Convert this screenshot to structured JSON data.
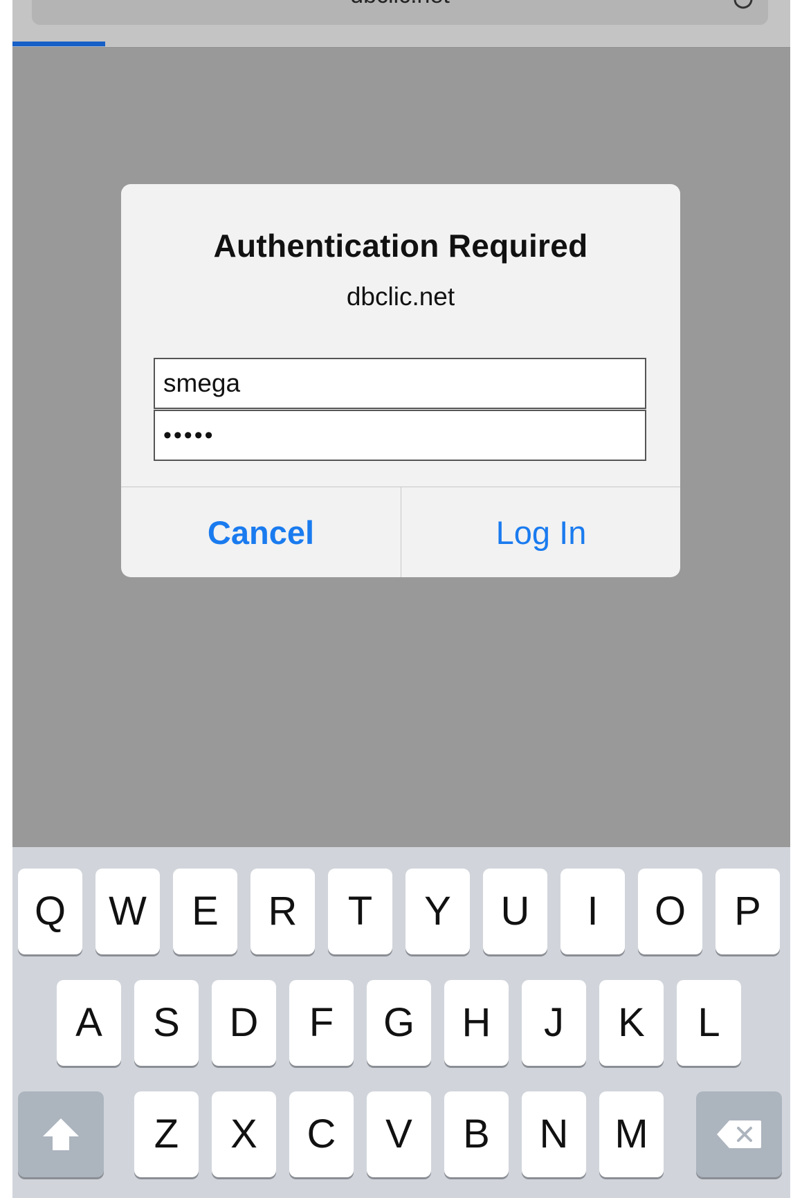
{
  "browser": {
    "url": "dbclic.net"
  },
  "dialog": {
    "title": "Authentication Required",
    "message": "dbclic.net",
    "username_value": "smega",
    "password_value": "•••••",
    "cancel_label": "Cancel",
    "login_label": "Log In"
  },
  "keyboard": {
    "row1": [
      "Q",
      "W",
      "E",
      "R",
      "T",
      "Y",
      "U",
      "I",
      "O",
      "P"
    ],
    "row2": [
      "A",
      "S",
      "D",
      "F",
      "G",
      "H",
      "J",
      "K",
      "L"
    ],
    "row3": [
      "Z",
      "X",
      "C",
      "V",
      "B",
      "N",
      "M"
    ],
    "shift_icon": "shift-arrow-icon",
    "delete_icon": "backspace-icon"
  },
  "colors": {
    "accent": "#1a7bef",
    "progress": "#1760c8",
    "overlay": "#999999",
    "keyboard_bg": "#d1d5db"
  }
}
